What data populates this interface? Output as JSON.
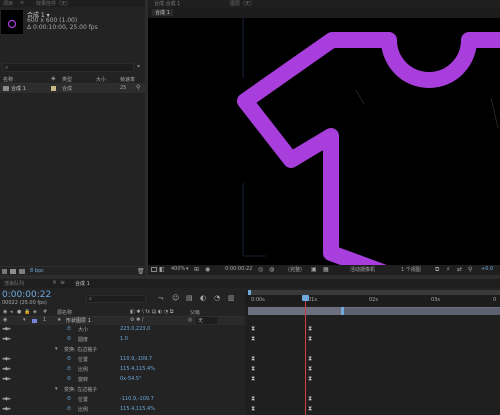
{
  "project": {
    "top_tabs": [
      "项目",
      "≡",
      "效果控件（无）"
    ],
    "thumb_name": "合成 1 ▾",
    "thumb_size": "600 x 600 (1.00)",
    "thumb_duration": "Δ 0:00:10:00, 25.00 fps",
    "search_placeholder": "",
    "col_name": "名称",
    "col_type": "类型",
    "col_size": "大小",
    "col_fps": "帧速率",
    "item": {
      "name": "合成 1",
      "type": "合成",
      "fps": "25"
    },
    "bpc": "8 bpc"
  },
  "viewer": {
    "header_tab": "合成 合成 1",
    "header_lock": "图层（无）",
    "breadcrumb": "合成 1",
    "shape_color": "#a83fdc",
    "zoom": "400%",
    "timecode": "0:00:00:22",
    "resolution": "(完整)",
    "camera": "活动摄像机",
    "views": "1 个视图",
    "offset": "+0.0"
  },
  "timeline": {
    "tab_render": "渲染队列",
    "tab_comp": "合成 1",
    "current_time": "0:00:00:22",
    "frame_info": "00022 (25.00 fps)",
    "col_source": "源名称",
    "col_parent": "父级",
    "parent_value": "无",
    "layer_num": "1",
    "layer_name": "形状图层 1",
    "ruler": [
      "0:00s",
      "01s",
      "02s",
      "03s"
    ],
    "props": [
      {
        "label": "大小",
        "value": "223.0,223.0",
        "indent": 3
      },
      {
        "label": "圆度",
        "value": "1.0",
        "indent": 3
      },
      {
        "label": "变换: 右边袖子",
        "value": "",
        "indent": 2
      },
      {
        "label": "位置",
        "value": "110.9,-109.7",
        "indent": 3
      },
      {
        "label": "比例",
        "value": "115.4,115.4%",
        "indent": 3
      },
      {
        "label": "旋转",
        "value": "0x-54.5°",
        "indent": 3
      },
      {
        "label": "变换: 左边袖子",
        "value": "",
        "indent": 2
      },
      {
        "label": "位置",
        "value": "-110.9,-109.7",
        "indent": 3
      },
      {
        "label": "比例",
        "value": "115.4,115.4%",
        "indent": 3
      }
    ]
  },
  "icons": {
    "search": "search-icon",
    "gear": "gear-icon",
    "folder": "folder-icon",
    "trash": "trash-icon",
    "stopwatch": "stopwatch-icon",
    "keyframe": "keyframe-icon",
    "eye": "eye-icon",
    "triangle": "disclosure-triangle-icon"
  }
}
